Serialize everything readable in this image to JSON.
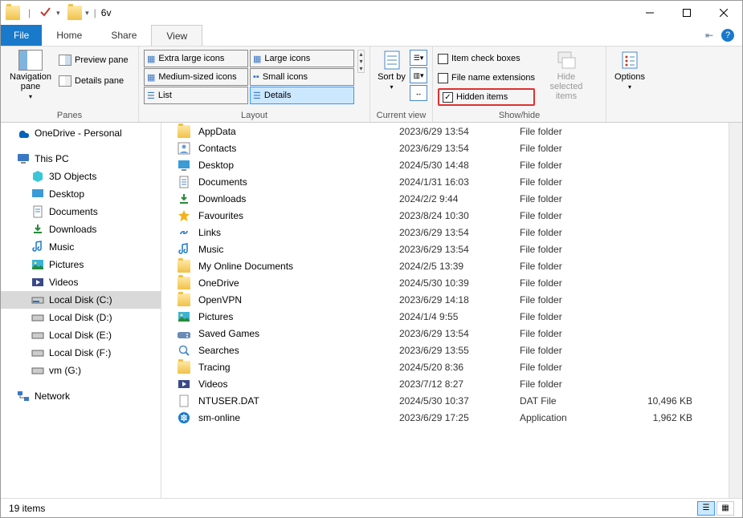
{
  "title": "6v",
  "tabs": {
    "file": "File",
    "home": "Home",
    "share": "Share",
    "view": "View"
  },
  "ribbon": {
    "panes_label": "Panes",
    "navpane": "Navigation pane",
    "preview": "Preview pane",
    "details_pane": "Details pane",
    "layout_label": "Layout",
    "layout": {
      "xl": "Extra large icons",
      "large": "Large icons",
      "medium": "Medium-sized icons",
      "small": "Small icons",
      "list": "List",
      "details": "Details"
    },
    "current_view_label": "Current view",
    "sort_by": "Sort by",
    "showhide_label": "Show/hide",
    "item_check": "Item check boxes",
    "file_ext": "File name extensions",
    "hidden": "Hidden items",
    "hide_selected": "Hide selected items",
    "options": "Options"
  },
  "tree": {
    "onedrive": "OneDrive - Personal",
    "thispc": "This PC",
    "objects3d": "3D Objects",
    "desktop": "Desktop",
    "documents": "Documents",
    "downloads": "Downloads",
    "music": "Music",
    "pictures": "Pictures",
    "videos": "Videos",
    "disk_c": "Local Disk (C:)",
    "disk_d": "Local Disk (D:)",
    "disk_e": "Local Disk (E:)",
    "disk_f": "Local Disk (F:)",
    "disk_g": "vm (G:)",
    "network": "Network"
  },
  "files": [
    {
      "name": "AppData",
      "date": "2023/6/29 13:54",
      "type": "File folder",
      "size": "",
      "icon": "folder"
    },
    {
      "name": "Contacts",
      "date": "2023/6/29 13:54",
      "type": "File folder",
      "size": "",
      "icon": "contacts"
    },
    {
      "name": "Desktop",
      "date": "2024/5/30 14:48",
      "type": "File folder",
      "size": "",
      "icon": "desktop"
    },
    {
      "name": "Documents",
      "date": "2024/1/31 16:03",
      "type": "File folder",
      "size": "",
      "icon": "documents"
    },
    {
      "name": "Downloads",
      "date": "2024/2/2 9:44",
      "type": "File folder",
      "size": "",
      "icon": "downloads"
    },
    {
      "name": "Favourites",
      "date": "2023/8/24 10:30",
      "type": "File folder",
      "size": "",
      "icon": "star"
    },
    {
      "name": "Links",
      "date": "2023/6/29 13:54",
      "type": "File folder",
      "size": "",
      "icon": "links"
    },
    {
      "name": "Music",
      "date": "2023/6/29 13:54",
      "type": "File folder",
      "size": "",
      "icon": "music"
    },
    {
      "name": "My Online Documents",
      "date": "2024/2/5 13:39",
      "type": "File folder",
      "size": "",
      "icon": "folder"
    },
    {
      "name": "OneDrive",
      "date": "2024/5/30 10:39",
      "type": "File folder",
      "size": "",
      "icon": "folder"
    },
    {
      "name": "OpenVPN",
      "date": "2023/6/29 14:18",
      "type": "File folder",
      "size": "",
      "icon": "folder"
    },
    {
      "name": "Pictures",
      "date": "2024/1/4 9:55",
      "type": "File folder",
      "size": "",
      "icon": "pictures"
    },
    {
      "name": "Saved Games",
      "date": "2023/6/29 13:54",
      "type": "File folder",
      "size": "",
      "icon": "games"
    },
    {
      "name": "Searches",
      "date": "2023/6/29 13:55",
      "type": "File folder",
      "size": "",
      "icon": "search"
    },
    {
      "name": "Tracing",
      "date": "2024/5/20 8:36",
      "type": "File folder",
      "size": "",
      "icon": "folder"
    },
    {
      "name": "Videos",
      "date": "2023/7/12 8:27",
      "type": "File folder",
      "size": "",
      "icon": "videos"
    },
    {
      "name": "NTUSER.DAT",
      "date": "2024/5/30 10:37",
      "type": "DAT File",
      "size": "10,496 KB",
      "icon": "file"
    },
    {
      "name": "sm-online",
      "date": "2023/6/29 17:25",
      "type": "Application",
      "size": "1,962 KB",
      "icon": "app"
    }
  ],
  "status": "19 items"
}
